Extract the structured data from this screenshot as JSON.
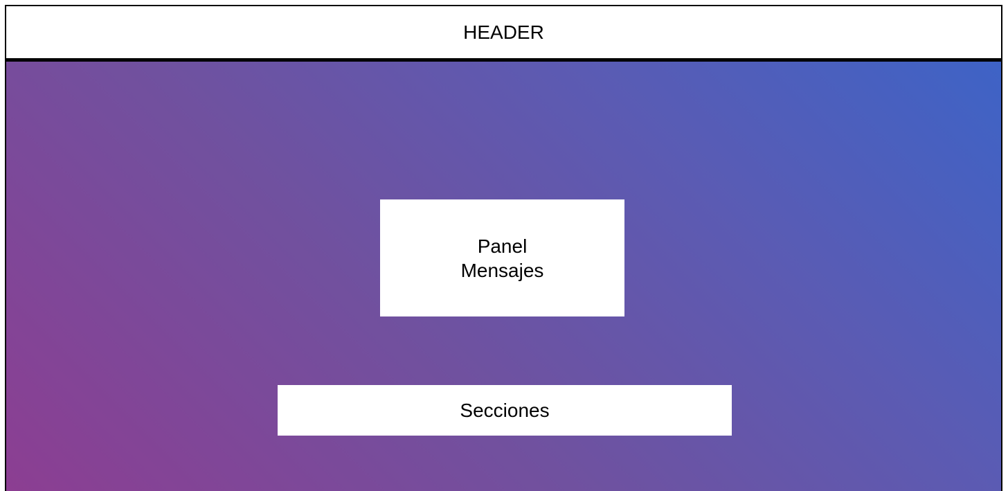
{
  "header": {
    "label": "HEADER"
  },
  "main": {
    "panel": {
      "line1": "Panel",
      "line2": "Mensajes"
    },
    "sections": {
      "label": "Secciones"
    },
    "gradient_colors": [
      "#8c3e92",
      "#70519f",
      "#5b5bb3",
      "#3e63c6"
    ]
  }
}
